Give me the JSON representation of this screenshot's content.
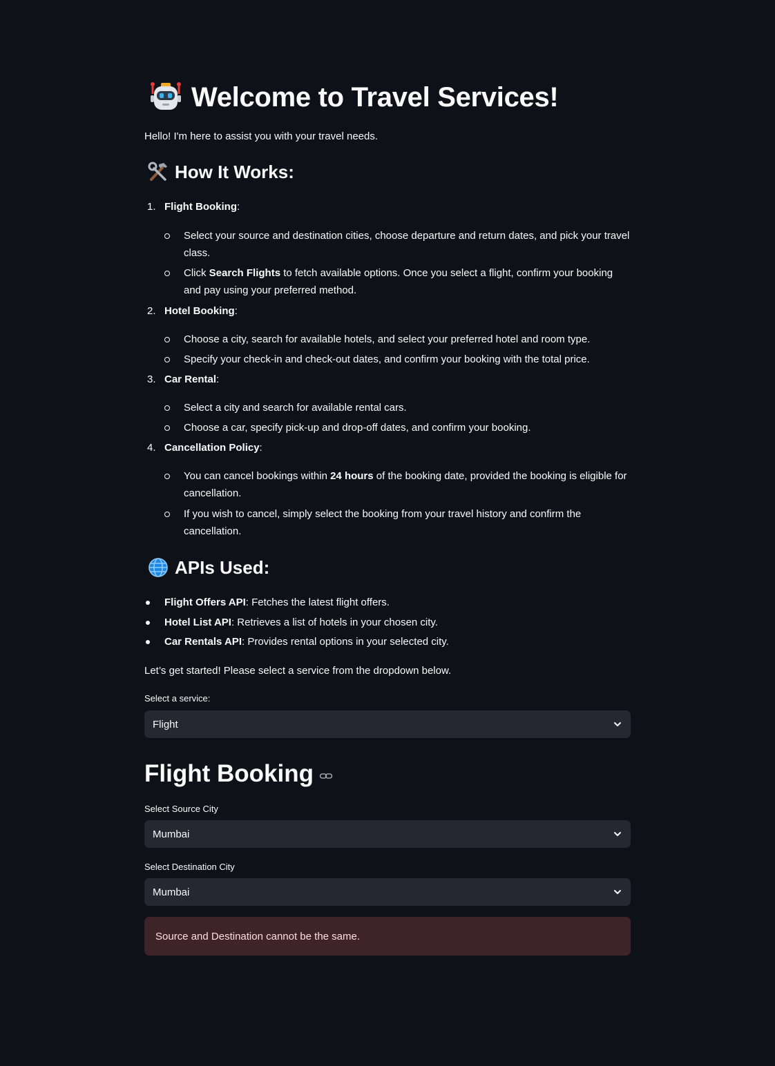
{
  "header": {
    "title": "Welcome to Travel Services!",
    "title_icon": "robot-icon",
    "intro": "Hello! I'm here to assist you with your travel needs."
  },
  "how_it_works": {
    "heading": "How It Works:",
    "icon": "tools-icon",
    "steps": [
      {
        "number": "1.",
        "title": "Flight Booking",
        "suffix": ":",
        "items": [
          {
            "text": "Select your source and destination cities, choose departure and return dates, and pick your travel class."
          },
          {
            "before": "Click ",
            "bold": "Search Flights",
            "after": " to fetch available options. Once you select a flight, confirm your booking and pay using your preferred method."
          }
        ]
      },
      {
        "number": "2.",
        "title": "Hotel Booking",
        "suffix": ":",
        "items": [
          {
            "text": "Choose a city, search for available hotels, and select your preferred hotel and room type."
          },
          {
            "text": "Specify your check-in and check-out dates, and confirm your booking with the total price."
          }
        ]
      },
      {
        "number": "3.",
        "title": "Car Rental",
        "suffix": ":",
        "items": [
          {
            "text": "Select a city and search for available rental cars."
          },
          {
            "text": "Choose a car, specify pick-up and drop-off dates, and confirm your booking."
          }
        ]
      },
      {
        "number": "4.",
        "title": "Cancellation Policy",
        "suffix": ":",
        "items": [
          {
            "before": "You can cancel bookings within ",
            "bold": "24 hours",
            "after": " of the booking date, provided the booking is eligible for cancellation."
          },
          {
            "text": "If you wish to cancel, simply select the booking from your travel history and confirm the cancellation."
          }
        ]
      }
    ]
  },
  "apis": {
    "heading": "APIs Used:",
    "icon": "globe-icon",
    "items": [
      {
        "name": "Flight Offers API",
        "desc": ": Fetches the latest flight offers."
      },
      {
        "name": "Hotel List API",
        "desc": ": Retrieves a list of hotels in your chosen city."
      },
      {
        "name": "Car Rentals API",
        "desc": ": Provides rental options in your selected city."
      }
    ]
  },
  "cta": "Let’s get started! Please select a service from the dropdown below.",
  "service_select": {
    "label": "Select a service:",
    "value": "Flight"
  },
  "flight_booking": {
    "heading": "Flight Booking",
    "source": {
      "label": "Select Source City",
      "value": "Mumbai"
    },
    "destination": {
      "label": "Select Destination City",
      "value": "Mumbai"
    },
    "error": "Source and Destination cannot be the same."
  },
  "colors": {
    "background": "#0e1117",
    "text": "#fafafa",
    "select_bg": "#262730",
    "error_bg": "#3e2428",
    "error_text": "#ffdede"
  }
}
